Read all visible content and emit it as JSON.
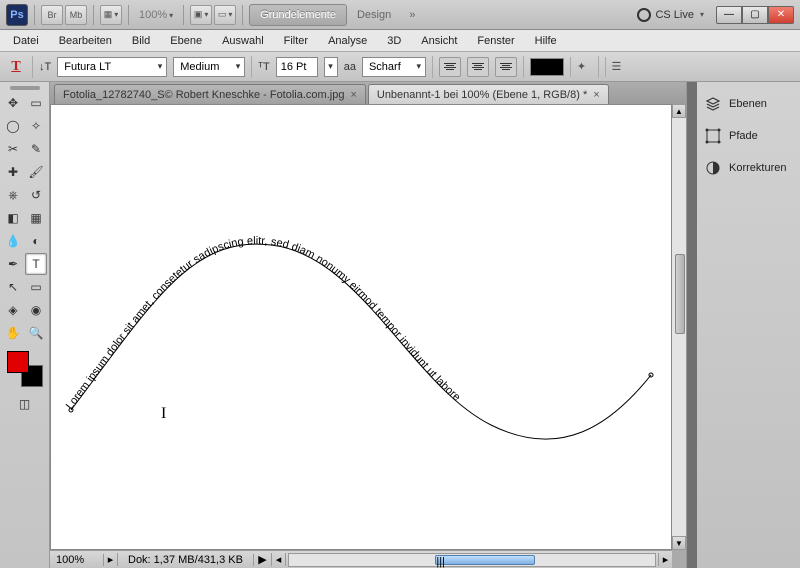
{
  "topbar": {
    "ps": "Ps",
    "br": "Br",
    "mb": "Mb",
    "zoom_pct": "100%",
    "btn_grund": "Grundelemente",
    "btn_design": "Design",
    "cslive": "CS Live"
  },
  "menu": {
    "datei": "Datei",
    "bearbeiten": "Bearbeiten",
    "bild": "Bild",
    "ebene": "Ebene",
    "auswahl": "Auswahl",
    "filter": "Filter",
    "analyse": "Analyse",
    "_3d": "3D",
    "ansicht": "Ansicht",
    "fenster": "Fenster",
    "hilfe": "Hilfe"
  },
  "opt": {
    "font": "Futura LT",
    "weight": "Medium",
    "size": "16 Pt",
    "aa_label": "aa",
    "aa_mode": "Scharf"
  },
  "tabs": {
    "inactive": "Fotolia_12782740_S© Robert Kneschke - Fotolia.com.jpg",
    "active": "Unbenannt-1 bei 100% (Ebene 1, RGB/8) *"
  },
  "canvas": {
    "path_text": "Lorem ipsum dolor sit amet, consetetur sadipscing elitr, sed diam nonumy eirmod tempor invidunt ut labore"
  },
  "status": {
    "zoom": "100%",
    "dok": "Dok: 1,37 MB/431,3 KB"
  },
  "panels": {
    "ebenen": "Ebenen",
    "pfade": "Pfade",
    "korrekturen": "Korrekturen"
  }
}
